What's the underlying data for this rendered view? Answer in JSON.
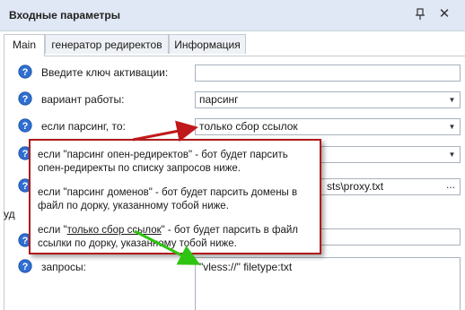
{
  "window": {
    "title": "Входные параметры"
  },
  "tabs": [
    {
      "label": "Main",
      "active": true
    },
    {
      "label": "генератор редиректов",
      "active": false
    },
    {
      "label": "Информация",
      "active": false
    }
  ],
  "form": {
    "activation_key": {
      "label": "Введите ключ активации:",
      "value": ""
    },
    "mode": {
      "label": "вариант работы:",
      "value": "парсинг"
    },
    "if_parsing": {
      "label": "если парсинг, то:",
      "value": "только сбор ссылок"
    },
    "row4": {
      "value": ""
    },
    "proxy_file": {
      "value": "sts\\proxy.txt",
      "button_label": "..."
    },
    "partial_label": "уд",
    "row6": {
      "value": ""
    },
    "queries": {
      "label": "запросы:",
      "value": "\"vless://\" filetype:txt"
    }
  },
  "callout": {
    "lines": [
      {
        "prefix": "если \"",
        "em": "",
        "text": "парсинг опен-редиректов\" - бот будет парсить опен-редиректы по списку запросов ниже."
      },
      {
        "prefix": "если \"",
        "em": "",
        "text": "парсинг доменов\" - бот будет парсить домены в файл по дорку, указанному тобой ниже."
      },
      {
        "prefix": "если \"",
        "em": "только сбор ссылок",
        "text": "\" - бот будет парсить в файл ссылки по дорку, указанному тобой ниже."
      }
    ]
  },
  "colors": {
    "callout_border": "#b0191b",
    "arrow_red": "#c0191b",
    "arrow_green": "#2fc412",
    "titlebar_bg": "#dfe8f4",
    "help_icon_fill": "#2f6fd1"
  },
  "icons": {
    "help": "question-circle-icon",
    "pin": "pin-icon",
    "close": "close-icon",
    "dropdown": "chevron-down-icon"
  }
}
